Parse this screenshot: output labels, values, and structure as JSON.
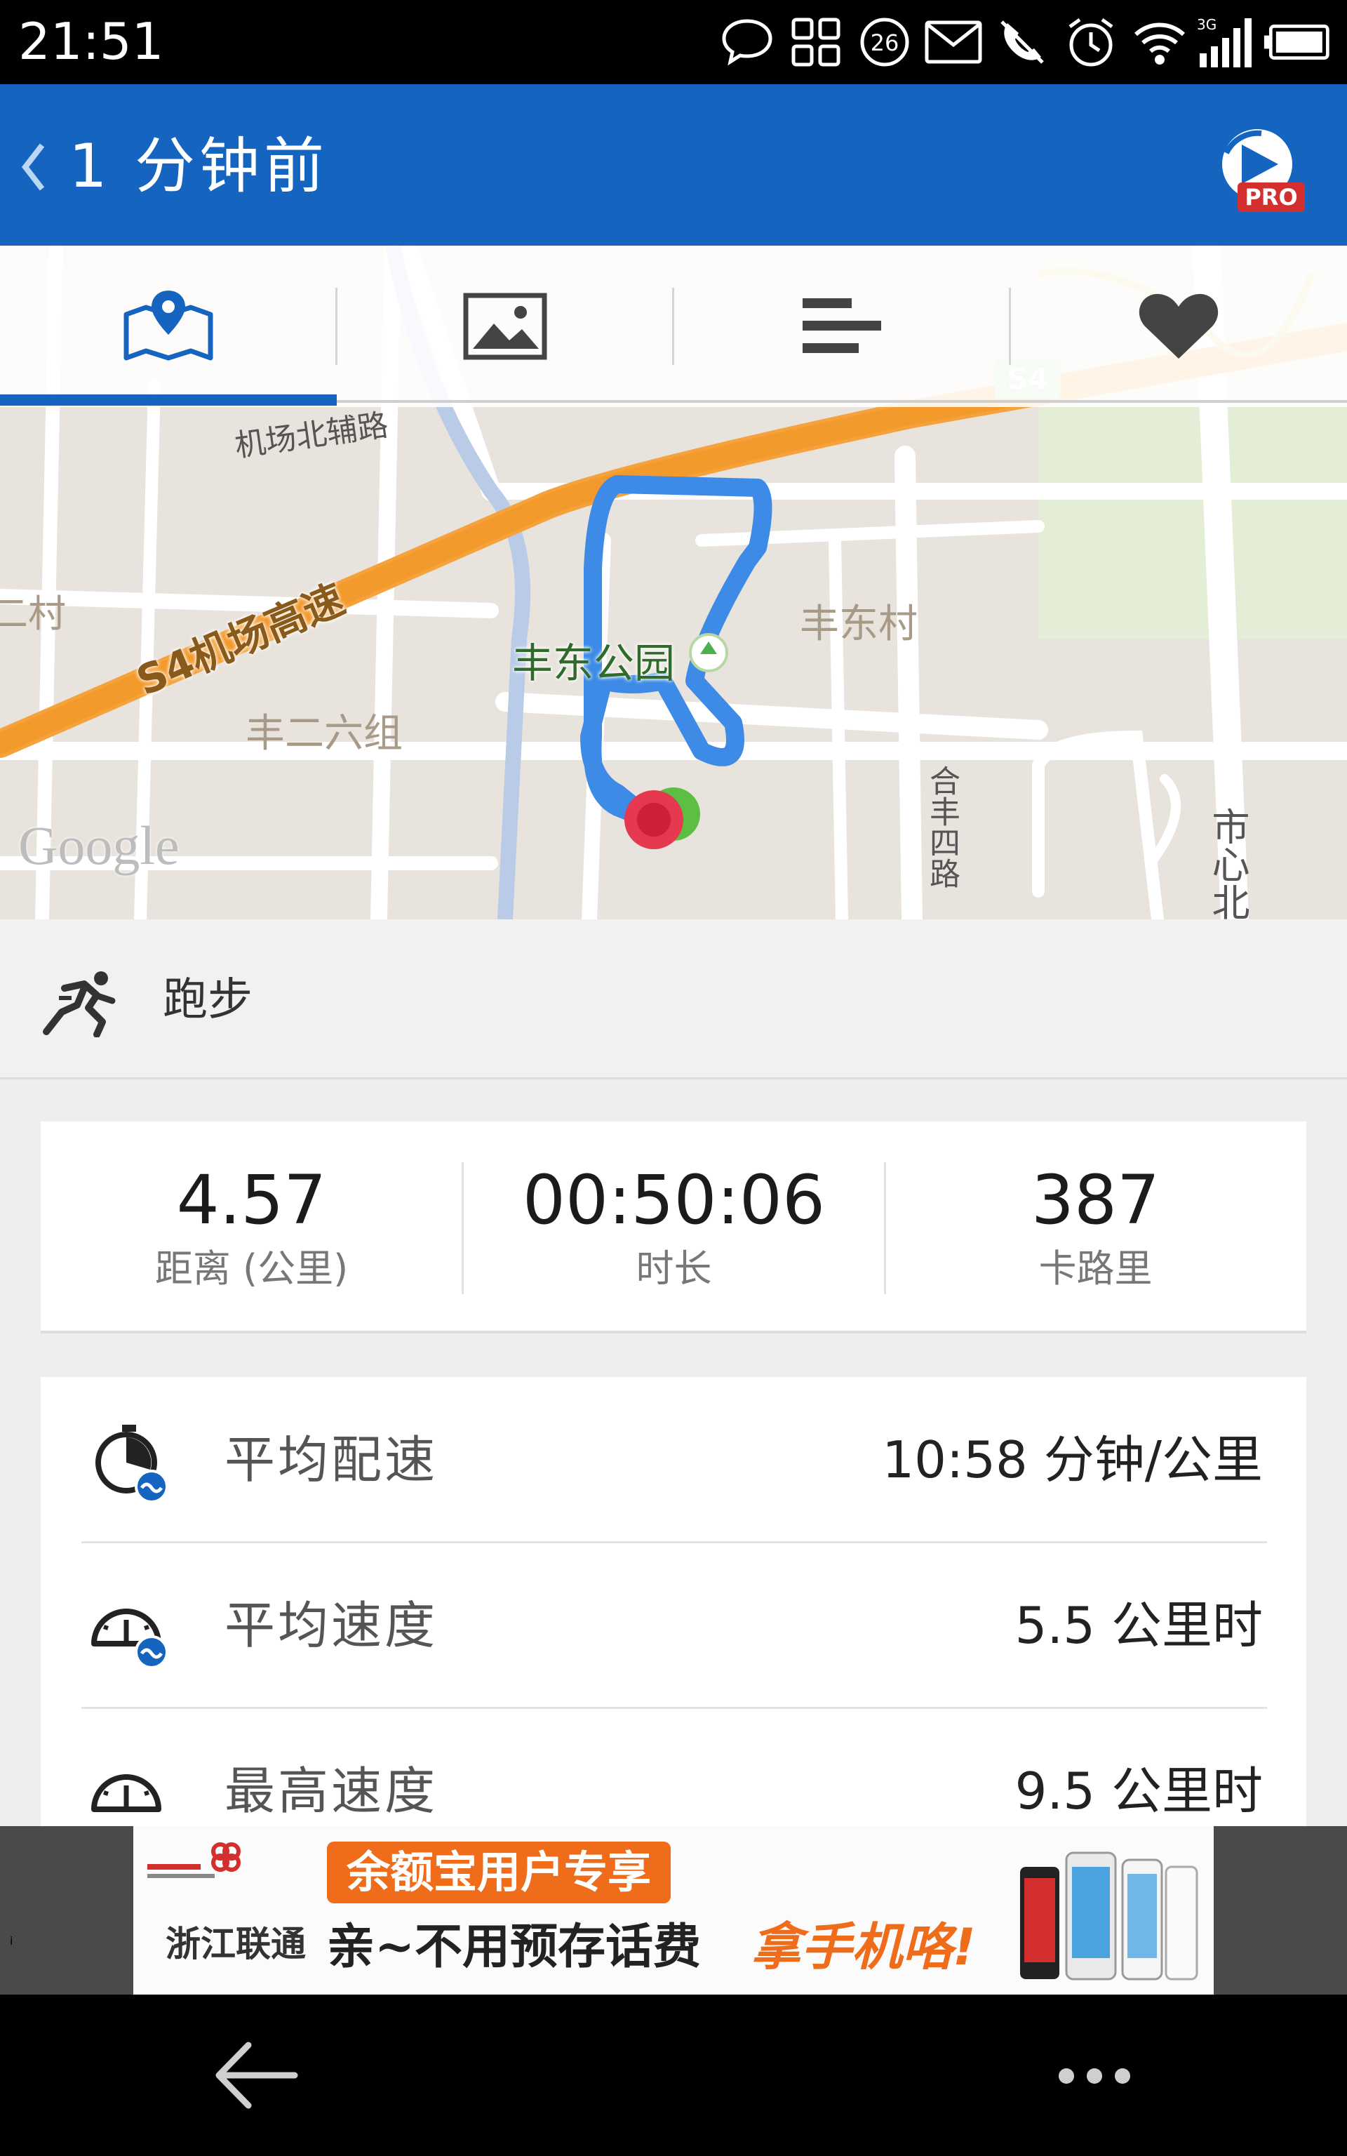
{
  "status_bar": {
    "time": "21:51",
    "badge_number": "26",
    "network_type": "3G",
    "icons": [
      "chat-bubble-icon",
      "grid-icon",
      "notification-count-icon",
      "mail-icon",
      "phone-silent-icon",
      "alarm-icon",
      "wifi-icon",
      "signal-icon",
      "battery-icon"
    ]
  },
  "action_bar": {
    "title": "1 分钟前",
    "pro_badge": "PRO",
    "accent_color": "#1565c0"
  },
  "tabs": [
    {
      "name": "map",
      "icon": "map-pin-icon",
      "selected": true
    },
    {
      "name": "photo",
      "icon": "photo-icon",
      "selected": false
    },
    {
      "name": "stats",
      "icon": "bar-chart-icon",
      "selected": false
    },
    {
      "name": "like",
      "icon": "heart-icon",
      "selected": false
    }
  ],
  "map": {
    "labels": {
      "road_north": "机场北辅路",
      "highway": "S4机场高速",
      "highway_badge": "S4",
      "village_left": "二村",
      "park": "丰东公园",
      "village_right": "丰东村",
      "group": "丰二六组",
      "road_he": "合丰四路",
      "road_right": "市心北",
      "provider": "Google"
    },
    "route_color": "#3d8be6",
    "start_color": "#4caf50",
    "end_color": "#e53950"
  },
  "activity": {
    "icon": "runner-icon",
    "label": "跑步"
  },
  "summary": [
    {
      "value": "4.57",
      "label": "距离 (公里)"
    },
    {
      "value": "00:50:06",
      "label": "时长"
    },
    {
      "value": "387",
      "label": "卡路里"
    }
  ],
  "details": [
    {
      "icon": "pace-timer-icon",
      "label": "平均配速",
      "value": "10:58 分钟/公里"
    },
    {
      "icon": "speedometer-avg-icon",
      "label": "平均速度",
      "value": "5.5 公里时"
    },
    {
      "icon": "speedometer-max-icon",
      "label": "最高速度",
      "value": "9.5 公里时"
    }
  ],
  "ad": {
    "carrier": "浙江联通",
    "banner": "余额宝用户专享",
    "slogan": "亲~不用预存话费",
    "cta": "拿手机咯!",
    "info_glyph": "i"
  },
  "nav": {
    "back_icon": "back-arrow-icon",
    "more_icon": "more-dots-icon"
  }
}
